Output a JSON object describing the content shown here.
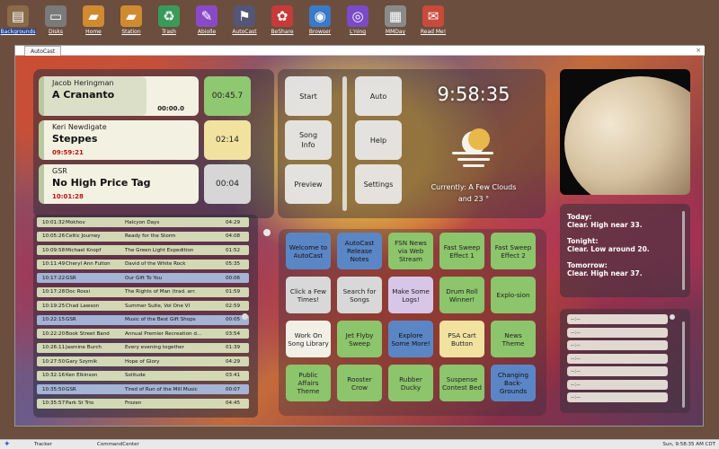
{
  "desktop": {
    "icons": [
      {
        "label": "Backgrounds",
        "glyph": "▤",
        "color": "#8a6a4a"
      },
      {
        "label": "Disks",
        "glyph": "▭",
        "color": "#7a7a7a"
      },
      {
        "label": "Home",
        "glyph": "▰",
        "color": "#d08a30"
      },
      {
        "label": "Station",
        "glyph": "▰",
        "color": "#d08a30"
      },
      {
        "label": "Trash",
        "glyph": "♻",
        "color": "#3a9a5a"
      },
      {
        "label": "Abiolle",
        "glyph": "✎",
        "color": "#8a4ac8"
      },
      {
        "label": "AutoCast",
        "glyph": "⚑",
        "color": "#555577"
      },
      {
        "label": "BeShare",
        "glyph": "✿",
        "color": "#c83a3a"
      },
      {
        "label": "Browser",
        "glyph": "◉",
        "color": "#3a7ac8"
      },
      {
        "label": "L'ning",
        "glyph": "◎",
        "color": "#7a4ac8"
      },
      {
        "label": "MMDay",
        "glyph": "▦",
        "color": "#8a8a8a"
      },
      {
        "label": "Read Me!",
        "glyph": "✉",
        "color": "#c84a3a"
      }
    ]
  },
  "window": {
    "tab_label": "AutoCast",
    "close_glyph": "×"
  },
  "now_playing": [
    {
      "artist": "Jacob Heringman",
      "title": "A Crananto",
      "time": "00:00.0",
      "timer": "00:45.7",
      "timer_color": "#8fc870",
      "progress": 0.66
    },
    {
      "artist": "Keri Newdigate",
      "title": "Steppes",
      "time": "09:59:21",
      "timer": "02:14",
      "timer_color": "#f1e2a0",
      "progress": 0
    },
    {
      "artist": "GSR",
      "title": "No High Price Tag",
      "time": "10:01:28",
      "timer": "00:04",
      "timer_color": "#d6d6d6",
      "progress": 0
    }
  ],
  "controls": {
    "start": "Start",
    "song_info_1": "Song",
    "song_info_2": "Info",
    "preview": "Preview",
    "auto": "Auto",
    "help": "Help",
    "settings": "Settings"
  },
  "clock": "9:58:35",
  "weather": {
    "line1": "Currently: A Few Clouds",
    "line2": "and 23 °"
  },
  "forecast": [
    {
      "head": "Today:",
      "body": "Clear. High near 33."
    },
    {
      "head": "Tonight:",
      "body": "Clear. Low around 20."
    },
    {
      "head": "Tomorrow:",
      "body": "Clear. High near 37."
    }
  ],
  "extra_list": [
    "--:--",
    "--:--",
    "--:--",
    "--:--",
    "--:--",
    "--:--",
    "--:--"
  ],
  "log": [
    {
      "time": "10:01:32",
      "artist": "Mokhov",
      "title": "Halcyon Days",
      "dur": "04:29",
      "kind": "song"
    },
    {
      "time": "10:05:26",
      "artist": "Celtic Journey",
      "title": "Ready for the Storm",
      "dur": "04:08",
      "kind": "song"
    },
    {
      "time": "10:09:58",
      "artist": "Michael Knopf",
      "title": "The Green Light Expedition",
      "dur": "01:52",
      "kind": "song"
    },
    {
      "time": "10:11:49",
      "artist": "Cheryl Ann Fulton",
      "title": "David of the White Rock",
      "dur": "05:35",
      "kind": "song"
    },
    {
      "time": "10:17:22",
      "artist": "GSR",
      "title": "Our Gift To You",
      "dur": "00:06",
      "kind": "id"
    },
    {
      "time": "10:17:28",
      "artist": "Doc Rossi",
      "title": "The Rights of Man (trad. arr.",
      "dur": "01:59",
      "kind": "song"
    },
    {
      "time": "10:19:25",
      "artist": "Chad Lawson",
      "title": "Summer Suite, Vol One VI",
      "dur": "02:59",
      "kind": "song"
    },
    {
      "time": "10:22:15",
      "artist": "GSR",
      "title": "Music of the Best Gift Shops",
      "dur": "00:05",
      "kind": "id"
    },
    {
      "time": "10:22:20",
      "artist": "Book Street Band",
      "title": "Annual Premier Recreation d...",
      "dur": "03:54",
      "kind": "song"
    },
    {
      "time": "10:26:11",
      "artist": "Jasmine Burch",
      "title": "Every evening together",
      "dur": "01:39",
      "kind": "song"
    },
    {
      "time": "10:27:50",
      "artist": "Gary Szymik",
      "title": "Hope of Glory",
      "dur": "04:29",
      "kind": "song"
    },
    {
      "time": "10:32:16",
      "artist": "Ken Elkinson",
      "title": "Solitude",
      "dur": "03:41",
      "kind": "song"
    },
    {
      "time": "10:35:50",
      "artist": "GSR",
      "title": "Tired of Run of the Mill Music",
      "dur": "00:07",
      "kind": "id"
    },
    {
      "time": "10:35:57",
      "artist": "Park St Trio",
      "title": "Frozen",
      "dur": "04:45",
      "kind": "song"
    }
  ],
  "carts": [
    {
      "label": "Welcome to AutoCast",
      "color": "blue"
    },
    {
      "label": "AutoCast Release Notes",
      "color": "blue"
    },
    {
      "label": "FSN News via Web Stream",
      "color": "green"
    },
    {
      "label": "Fast Sweep Effect 1",
      "color": "green"
    },
    {
      "label": "Fast Sweep Effect 2",
      "color": "green"
    },
    {
      "label": "Click a Few Times!",
      "color": "gray"
    },
    {
      "label": "Search for Songs",
      "color": "gray"
    },
    {
      "label": "Make Some Logs!",
      "color": "lav"
    },
    {
      "label": "Drum Roll Winner!",
      "color": "green"
    },
    {
      "label": "Explo-sion",
      "color": "green"
    },
    {
      "label": "Work On Song Library",
      "color": "white"
    },
    {
      "label": "Jet Flyby Sweep",
      "color": "green"
    },
    {
      "label": "Explore Some More!",
      "color": "blue"
    },
    {
      "label": "PSA Cart Button",
      "color": "yellow"
    },
    {
      "label": "News Theme",
      "color": "green"
    },
    {
      "label": "Public Affairs Theme",
      "color": "green"
    },
    {
      "label": "Rooster Crow",
      "color": "green"
    },
    {
      "label": "Rubber Ducky",
      "color": "green"
    },
    {
      "label": "Suspense Contest Bed",
      "color": "green"
    },
    {
      "label": "Changing Back-Grounds",
      "color": "blue"
    }
  ],
  "taskbar": {
    "task1": "Tracker",
    "task2": "CommandCenter",
    "tray": "Sun, 9:58:35 AM CDT"
  }
}
